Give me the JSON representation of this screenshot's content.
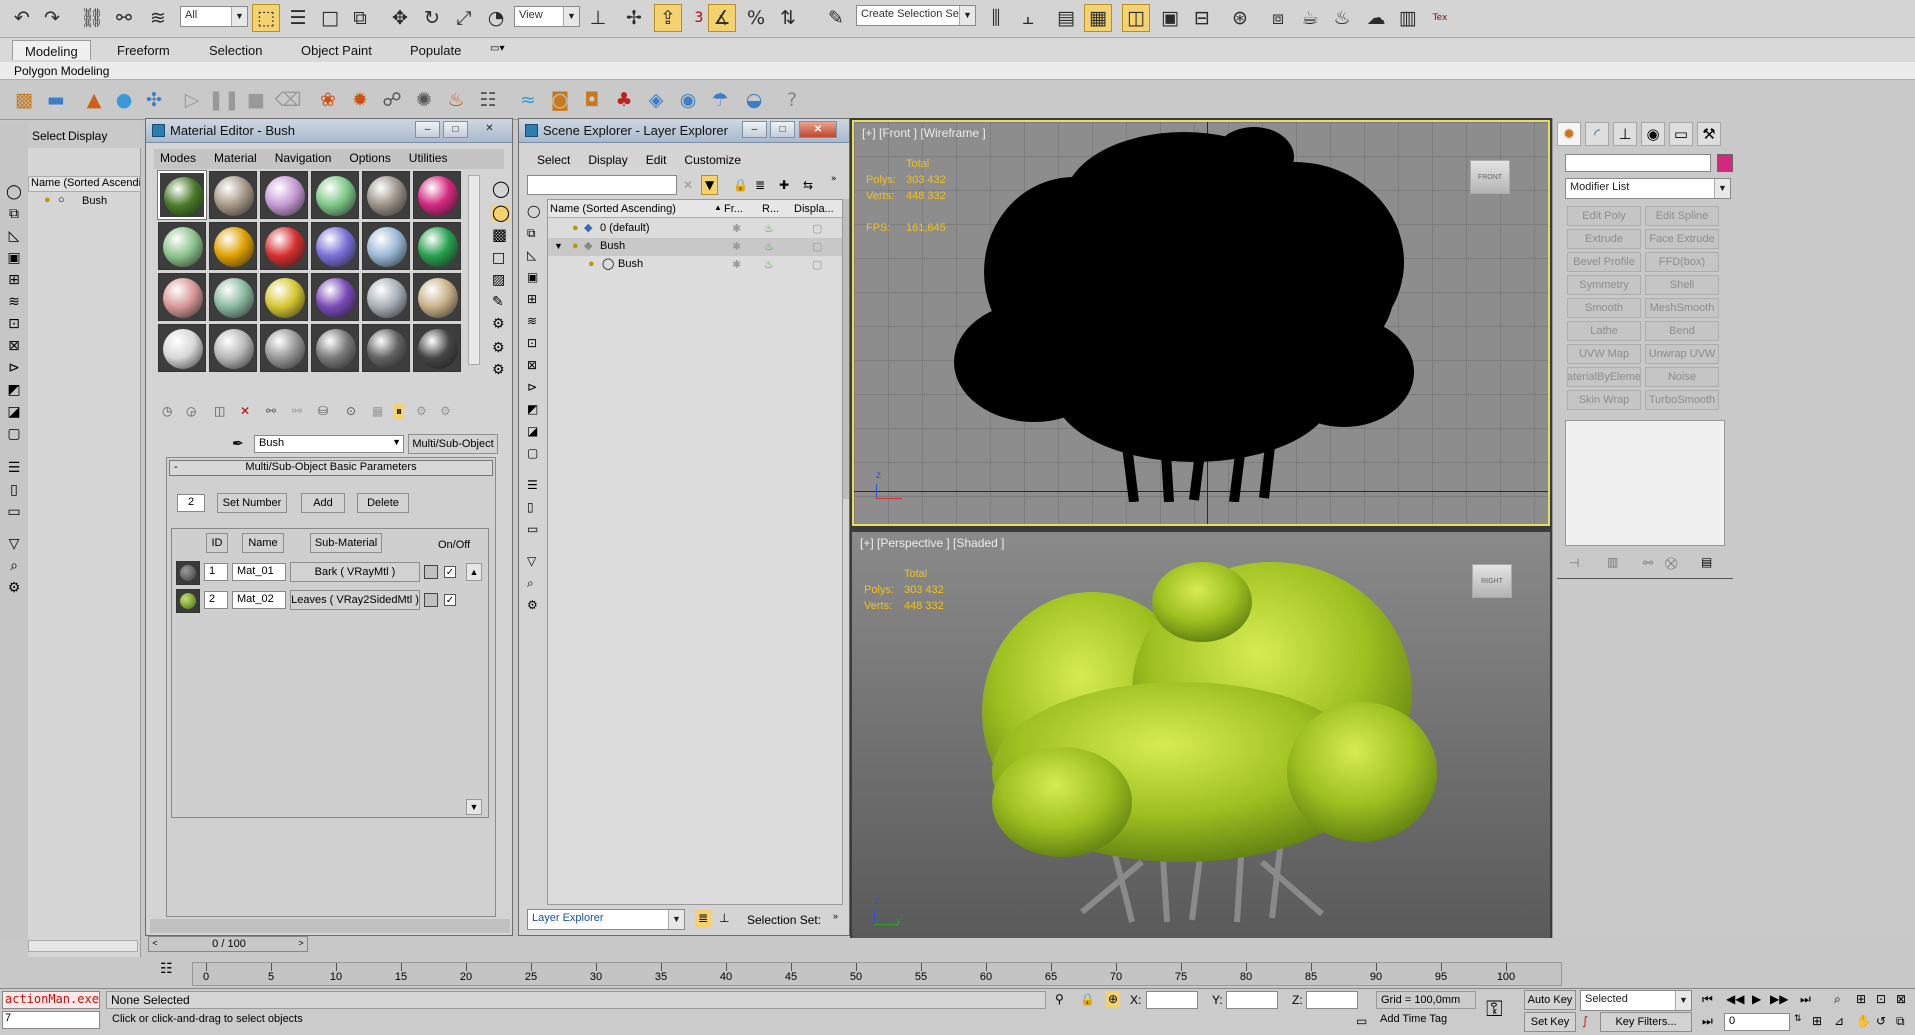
{
  "colors": {
    "accent": "#f5d270",
    "viewport_border": "#e8dc5a",
    "stats": "#f0c020",
    "pink": "#d4287f"
  },
  "toolbar": {
    "filter_value": "All",
    "view_value": "View",
    "selection_set_placeholder": "Create Selection Se",
    "snap_label": "3",
    "icons": [
      "undo-icon",
      "redo-icon",
      "link-icon",
      "unlink-icon",
      "bind-spacewarp-icon",
      "select-icon",
      "select-by-name-icon",
      "rect-selection-icon",
      "window-crossing-icon",
      "move-icon",
      "rotate-icon",
      "scale-icon",
      "reference-coord-icon",
      "pivot-icon",
      "manipulate-icon",
      "snap-toggle-icon",
      "angle-snap-icon",
      "percent-snap-icon",
      "spinner-snap-icon",
      "edit-named-sets-icon",
      "mirror-icon",
      "align-icon",
      "layer-manager-icon",
      "graphite-icon",
      "curve-editor-icon",
      "schematic-icon",
      "material-editor-icon",
      "render-setup-icon",
      "rendered-frame-icon",
      "render-icon",
      "teapot-icon",
      "render-iterative-icon",
      "texture-tools-icon"
    ]
  },
  "ribbon": {
    "tabs": [
      "Modeling",
      "Freeform",
      "Selection",
      "Object Paint",
      "Populate"
    ],
    "subtitle": "Polygon Modeling"
  },
  "outliner": {
    "tabs": [
      "Select",
      "Display"
    ],
    "header": "Name (Sorted Ascending",
    "item": "Bush"
  },
  "material_editor": {
    "title": "Material Editor - Bush",
    "menus": [
      "Modes",
      "Material",
      "Navigation",
      "Options",
      "Utilities"
    ],
    "material_name": "Bush",
    "material_type": "Multi/Sub-Object",
    "rollout_title": "Multi/Sub-Object Basic Parameters",
    "count": "2",
    "set_number": "Set Number",
    "add": "Add",
    "delete": "Delete",
    "col_id": "ID",
    "col_name": "Name",
    "col_sub": "Sub-Material",
    "col_onoff": "On/Off",
    "rows": [
      {
        "id": "1",
        "name": "Mat_01",
        "sub": "Bark  ( VRayMtl )",
        "on": "✓"
      },
      {
        "id": "2",
        "name": "Mat_02",
        "sub": "Leaves  ( VRay2SidedMtl )",
        "on": "✓"
      }
    ],
    "spheres": [
      "#4a7a2a",
      "#a89a8a",
      "#c79bd6",
      "#7fc98a",
      "#9c9388",
      "#d4287f",
      "#8fc48f",
      "#e0a000",
      "#d63030",
      "#7a70d8",
      "#9ab8d6",
      "#28a050",
      "#d99898",
      "#8ab8a0",
      "#d6c630",
      "#7a4ab8",
      "#a8b0b8",
      "#c8b088",
      "#d8d8d8",
      "#b8b8b8",
      "#989898",
      "#7a7a7a",
      "#626262",
      "#464646"
    ],
    "scroll_pos": "0 / 100"
  },
  "scene_explorer": {
    "title": "Scene Explorer - Layer Explorer",
    "menus": [
      "Select",
      "Display",
      "Edit",
      "Customize"
    ],
    "col_name": "Name (Sorted Ascending)",
    "col_fr": "Fr...",
    "col_r": "R...",
    "col_disp": "Displa...",
    "rows": [
      {
        "name": "0 (default)"
      },
      {
        "name": "Bush"
      },
      {
        "name": "Bush"
      }
    ],
    "footer_combo": "Layer Explorer",
    "selection_set": "Selection Set:"
  },
  "viewport_front": {
    "label": "[+] [Front ] [Wireframe ]",
    "stats_total": "Total",
    "polys_label": "Polys:",
    "polys": "303 432",
    "verts_label": "Verts:",
    "verts": "448 332",
    "fps_label": "FPS:",
    "fps": "161,645",
    "cube": "FRONT"
  },
  "viewport_persp": {
    "label": "[+] [Perspective ] [Shaded ]",
    "stats_total": "Total",
    "polys_label": "Polys:",
    "polys": "303 432",
    "verts_label": "Verts:",
    "verts": "448 332",
    "cube": "RIGHT"
  },
  "command_panel": {
    "modifier_list": "Modifier List",
    "buttons": [
      "Edit Poly",
      "Edit Spline",
      "Extrude",
      "Face Extrude",
      "Bevel Profile",
      "FFD(box)",
      "Symmetry",
      "Shell",
      "Smooth",
      "MeshSmooth",
      "Lathe",
      "Bend",
      "UVW Map",
      "Unwrap UVW",
      "aterialByEleme",
      "Noise",
      "Skin Wrap",
      "TurboSmooth"
    ]
  },
  "timeline": {
    "ticks": [
      "0",
      "5",
      "10",
      "15",
      "20",
      "25",
      "30",
      "35",
      "40",
      "45",
      "50",
      "55",
      "60",
      "65",
      "70",
      "75",
      "80",
      "85",
      "90",
      "95",
      "100"
    ]
  },
  "status": {
    "script": "actionMan.exe",
    "script_val": "7",
    "selection": "None Selected",
    "prompt": "Click or click-and-drag to select objects",
    "x_label": "X:",
    "y_label": "Y:",
    "z_label": "Z:",
    "grid": "Grid = 100,0mm",
    "add_time_tag": "Add Time Tag",
    "auto_key": "Auto Key",
    "set_key": "Set Key",
    "selected": "Selected",
    "key_filters": "Key Filters...",
    "frame": "0"
  }
}
